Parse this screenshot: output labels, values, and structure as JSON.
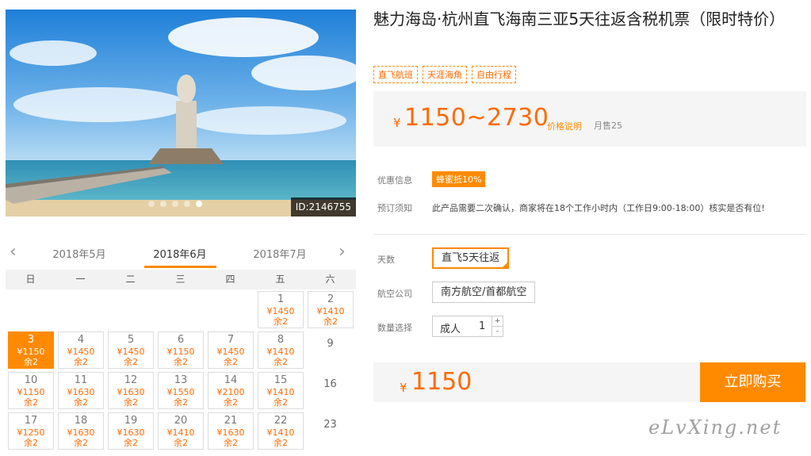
{
  "hero": {
    "id_label": "ID:2146755",
    "dot_count": 5,
    "active_dot": 4
  },
  "calendar": {
    "prev_arrow": "‹",
    "next_arrow": "›",
    "months": [
      "2018年5月",
      "2018年6月",
      "2018年7月"
    ],
    "active_month": 1,
    "weekdays": [
      "日",
      "一",
      "二",
      "三",
      "四",
      "五",
      "六"
    ],
    "leading_blanks": 5,
    "days": [
      {
        "day": "1",
        "price": "¥1450",
        "stock": "余2"
      },
      {
        "day": "2",
        "price": "¥1410",
        "stock": "余2"
      },
      {
        "day": "3",
        "price": "¥1150",
        "stock": "余2",
        "selected": true
      },
      {
        "day": "4",
        "price": "¥1450",
        "stock": "余2"
      },
      {
        "day": "5",
        "price": "¥1450",
        "stock": "余2"
      },
      {
        "day": "6",
        "price": "¥1150",
        "stock": "余2"
      },
      {
        "day": "7",
        "price": "¥1450",
        "stock": "余2"
      },
      {
        "day": "8",
        "price": "¥1410",
        "stock": "余2"
      },
      {
        "day": "9"
      },
      {
        "day": "10",
        "price": "¥1150",
        "stock": "余2"
      },
      {
        "day": "11",
        "price": "¥1630",
        "stock": "余2"
      },
      {
        "day": "12",
        "price": "¥1630",
        "stock": "余2"
      },
      {
        "day": "13",
        "price": "¥1550",
        "stock": "余2"
      },
      {
        "day": "14",
        "price": "¥2100",
        "stock": "余2"
      },
      {
        "day": "15",
        "price": "¥1410",
        "stock": "余2"
      },
      {
        "day": "16"
      },
      {
        "day": "17",
        "price": "¥1250",
        "stock": "余2"
      },
      {
        "day": "18",
        "price": "¥1630",
        "stock": "余2"
      },
      {
        "day": "19",
        "price": "¥1630",
        "stock": "余2"
      },
      {
        "day": "20",
        "price": "¥1410",
        "stock": "余2"
      },
      {
        "day": "21",
        "price": "¥1630",
        "stock": "余2"
      },
      {
        "day": "22",
        "price": "¥1410",
        "stock": "余2"
      },
      {
        "day": "23"
      }
    ]
  },
  "product": {
    "title": "魅力海岛·杭州直飞海南三亚5天往返含税机票（限时特价）",
    "tags": [
      "直飞航班",
      "天涯海角",
      "自由行程"
    ],
    "price_currency": "¥",
    "price_range": "1150~2730",
    "price_note": "价格说明",
    "monthly_sales": "月售25"
  },
  "info": {
    "promo_label": "优惠信息",
    "promo_badge": "蜂蜜抵10%",
    "notice_label": "预订须知",
    "notice_text": "此产品需要二次确认，商家将在18个工作小时内（工作日9:00-18:00）核实是否有位!"
  },
  "options": {
    "days_label": "天数",
    "days_value": "直飞5天往返",
    "airline_label": "航空公司",
    "airline_value": "南方航空/首都航空",
    "qty_label": "数量选择",
    "qty_type": "成人",
    "qty_value": "1",
    "qty_plus": "+",
    "qty_minus": "-"
  },
  "buy": {
    "currency": "¥",
    "amount": "1150",
    "button": "立即购买"
  },
  "watermark": "eLvXing.net",
  "colors": {
    "accent": "#ff8a00",
    "price": "#ff6a00"
  }
}
